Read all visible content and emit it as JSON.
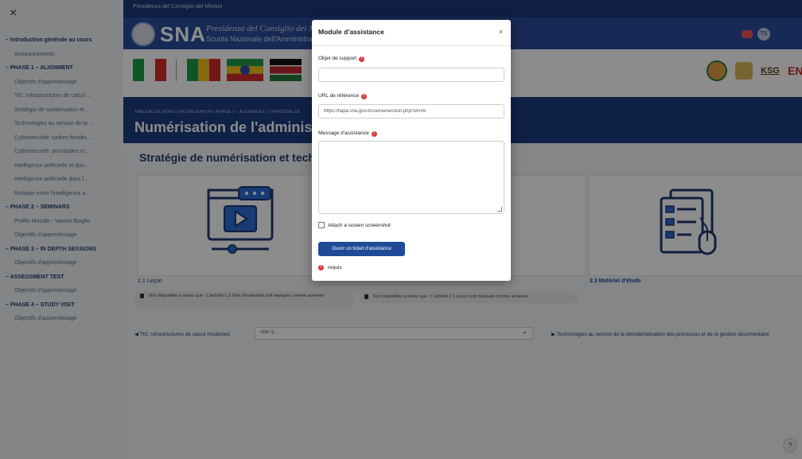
{
  "sidebar": {
    "close_glyph": "×",
    "items": [
      {
        "label": "Introduction générale au cours",
        "type": "section"
      },
      {
        "label": "Announcements",
        "type": "sub"
      },
      {
        "label": "PHASE 1 – ALIGNMENT",
        "type": "section"
      },
      {
        "label": "Objectifs d'apprentissage",
        "type": "sub"
      },
      {
        "label": "TIC: infrastructures de calcul ...",
        "type": "sub"
      },
      {
        "label": "Stratégie de numérisation et ...",
        "type": "sub"
      },
      {
        "label": "Technologies au service de la ...",
        "type": "sub"
      },
      {
        "label": "Cybersécurité: cadres fondés...",
        "type": "sub"
      },
      {
        "label": "Cybersécurité: principales m...",
        "type": "sub"
      },
      {
        "label": "Intelligence artificielle et don...",
        "type": "sub"
      },
      {
        "label": "Intelligence artificielle dans l...",
        "type": "sub"
      },
      {
        "label": "Relation entre l'intelligence a...",
        "type": "sub"
      },
      {
        "label": "PHASE 2 – SEMINARS",
        "type": "section"
      },
      {
        "label": "Profilo Moodle - Valerio Bioglio",
        "type": "sub"
      },
      {
        "label": "Objectifs d'apprentissage",
        "type": "sub"
      },
      {
        "label": "PHASE 3 – IN DEPTH SESSIONS",
        "type": "section"
      },
      {
        "label": "Objectifs d'apprentissage",
        "type": "sub"
      },
      {
        "label": "ASSESSMENT TEST",
        "type": "section"
      },
      {
        "label": "Objectifs d'apprentissage",
        "type": "sub"
      },
      {
        "label": "PHASE 4 – STUDY VISIT",
        "type": "section"
      },
      {
        "label": "Objectifs d'apprentissage",
        "type": "sub"
      }
    ]
  },
  "header": {
    "topbar_text": "Presidenza del Consiglio dei Ministri",
    "brand": "SNA",
    "brand_sub1": "Presidenza del Consiglio dei Ministri",
    "brand_sub2": "Scuola Nazionale dell'Amministrazione",
    "user_initials": "TS",
    "logo_text": "KSG",
    "logo_text2": "ENA"
  },
  "page": {
    "breadcrumb": "TABLEAU DE BORD  |  DIGITALISATION  |  PHASE 1 – ALIGNMENT  |  STRATÉGIE DE",
    "title": "Numérisation de l'administratio",
    "section_title": "Stratégie de numérisation et techno",
    "activity1_caption": "2.1 Leçon",
    "activity3_caption": "2.3 Matériel d'étude",
    "restrict1": "Non disponible à moins que : L'activité 1.2 Test d'évaluation soit marquée comme achevée",
    "restrict2": "Non disponible à moins que : L'activité 2.1 Leçon soit marquée comme achevée",
    "prev_link": "◀ TIC: infrastructures de calcul modernes",
    "jump_placeholder": "Aller à...",
    "next_link": "▶ Technologies au service de la dématérialisation des processus et de la gestion documentaire"
  },
  "modal": {
    "title": "Module d'assistance",
    "close_glyph": "×",
    "support_label": "Objet de support",
    "support_value": "",
    "url_label": "URL de référence",
    "url_value": "https://fiapa.sna.gov.it/course/section.php?id=59",
    "message_label": "Message d'assistance",
    "screenshot_label": "Attach a screen screenshot",
    "submit_label": "Ouvrir un ticket d'assistance",
    "required_note": "requis",
    "required_glyph": "!"
  },
  "colors": {
    "primary": "#1f4b96",
    "header_dark": "#1a3a7a",
    "required": "#d83a3a"
  }
}
